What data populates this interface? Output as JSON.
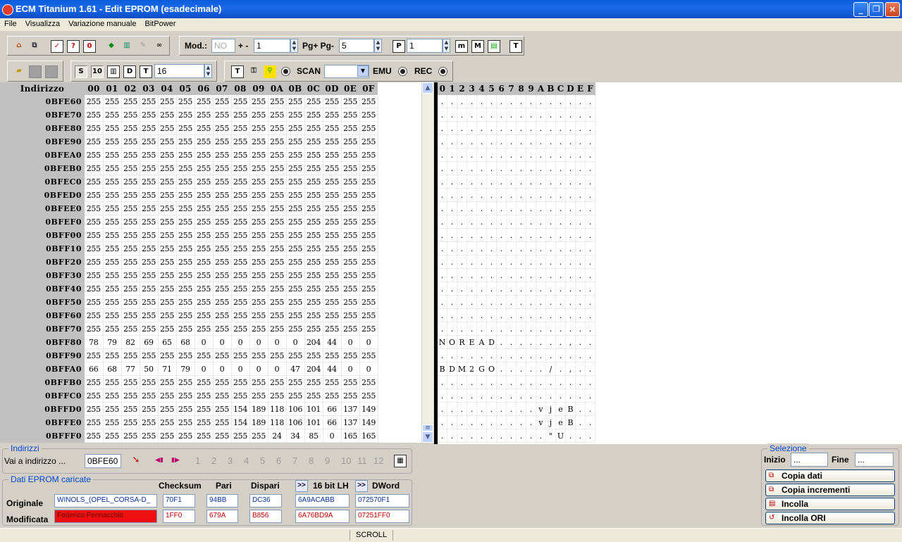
{
  "window": {
    "title": "ECM Titanium 1.61 - Edit EPROM (esadecimale)"
  },
  "menu": [
    "File",
    "Visualizza",
    "Variazione manuale",
    "BitPower"
  ],
  "toolbar1": {
    "mod_label": "Mod.:",
    "mod_value": "NO",
    "plusminus_label": "+ -",
    "plusminus_value": "1",
    "pg_label": "Pg+ Pg-",
    "pg_value": "5",
    "p_value": "1"
  },
  "toolbar2": {
    "width_value": "16",
    "scan_label": "SCAN",
    "scan_value": "",
    "emu_label": "EMU",
    "rec_label": "REC"
  },
  "hexgrid": {
    "address_header": "Indirizzo",
    "columns": [
      "00",
      "01",
      "02",
      "03",
      "04",
      "05",
      "06",
      "07",
      "08",
      "09",
      "0A",
      "0B",
      "0C",
      "0D",
      "0E",
      "0F"
    ],
    "rows": [
      {
        "addr": "0BFE60",
        "vals": [
          "255",
          "255",
          "255",
          "255",
          "255",
          "255",
          "255",
          "255",
          "255",
          "255",
          "255",
          "255",
          "255",
          "255",
          "255",
          "255"
        ],
        "ascii": [
          ".",
          ".",
          ".",
          ".",
          ".",
          ".",
          ".",
          ".",
          ".",
          ".",
          ".",
          ".",
          ".",
          ".",
          ".",
          "."
        ]
      },
      {
        "addr": "0BFE70",
        "vals": [
          "255",
          "255",
          "255",
          "255",
          "255",
          "255",
          "255",
          "255",
          "255",
          "255",
          "255",
          "255",
          "255",
          "255",
          "255",
          "255"
        ],
        "ascii": [
          ".",
          ".",
          ".",
          ".",
          ".",
          ".",
          ".",
          ".",
          ".",
          ".",
          ".",
          ".",
          ".",
          ".",
          ".",
          "."
        ]
      },
      {
        "addr": "0BFE80",
        "vals": [
          "255",
          "255",
          "255",
          "255",
          "255",
          "255",
          "255",
          "255",
          "255",
          "255",
          "255",
          "255",
          "255",
          "255",
          "255",
          "255"
        ],
        "ascii": [
          ".",
          ".",
          ".",
          ".",
          ".",
          ".",
          ".",
          ".",
          ".",
          ".",
          ".",
          ".",
          ".",
          ".",
          ".",
          "."
        ]
      },
      {
        "addr": "0BFE90",
        "vals": [
          "255",
          "255",
          "255",
          "255",
          "255",
          "255",
          "255",
          "255",
          "255",
          "255",
          "255",
          "255",
          "255",
          "255",
          "255",
          "255"
        ],
        "ascii": [
          ".",
          ".",
          ".",
          ".",
          ".",
          ".",
          ".",
          ".",
          ".",
          ".",
          ".",
          ".",
          ".",
          ".",
          ".",
          "."
        ]
      },
      {
        "addr": "0BFEA0",
        "vals": [
          "255",
          "255",
          "255",
          "255",
          "255",
          "255",
          "255",
          "255",
          "255",
          "255",
          "255",
          "255",
          "255",
          "255",
          "255",
          "255"
        ],
        "ascii": [
          ".",
          ".",
          ".",
          ".",
          ".",
          ".",
          ".",
          ".",
          ".",
          ".",
          ".",
          ".",
          ".",
          ".",
          ".",
          "."
        ]
      },
      {
        "addr": "0BFEB0",
        "vals": [
          "255",
          "255",
          "255",
          "255",
          "255",
          "255",
          "255",
          "255",
          "255",
          "255",
          "255",
          "255",
          "255",
          "255",
          "255",
          "255"
        ],
        "ascii": [
          ".",
          ".",
          ".",
          ".",
          ".",
          ".",
          ".",
          ".",
          ".",
          ".",
          ".",
          ".",
          ".",
          ".",
          ".",
          "."
        ]
      },
      {
        "addr": "0BFEC0",
        "vals": [
          "255",
          "255",
          "255",
          "255",
          "255",
          "255",
          "255",
          "255",
          "255",
          "255",
          "255",
          "255",
          "255",
          "255",
          "255",
          "255"
        ],
        "ascii": [
          ".",
          ".",
          ".",
          ".",
          ".",
          ".",
          ".",
          ".",
          ".",
          ".",
          ".",
          ".",
          ".",
          ".",
          ".",
          "."
        ]
      },
      {
        "addr": "0BFED0",
        "vals": [
          "255",
          "255",
          "255",
          "255",
          "255",
          "255",
          "255",
          "255",
          "255",
          "255",
          "255",
          "255",
          "255",
          "255",
          "255",
          "255"
        ],
        "ascii": [
          ".",
          ".",
          ".",
          ".",
          ".",
          ".",
          ".",
          ".",
          ".",
          ".",
          ".",
          ".",
          ".",
          ".",
          ".",
          "."
        ]
      },
      {
        "addr": "0BFEE0",
        "vals": [
          "255",
          "255",
          "255",
          "255",
          "255",
          "255",
          "255",
          "255",
          "255",
          "255",
          "255",
          "255",
          "255",
          "255",
          "255",
          "255"
        ],
        "ascii": [
          ".",
          ".",
          ".",
          ".",
          ".",
          ".",
          ".",
          ".",
          ".",
          ".",
          ".",
          ".",
          ".",
          ".",
          ".",
          "."
        ]
      },
      {
        "addr": "0BFEF0",
        "vals": [
          "255",
          "255",
          "255",
          "255",
          "255",
          "255",
          "255",
          "255",
          "255",
          "255",
          "255",
          "255",
          "255",
          "255",
          "255",
          "255"
        ],
        "ascii": [
          ".",
          ".",
          ".",
          ".",
          ".",
          ".",
          ".",
          ".",
          ".",
          ".",
          ".",
          ".",
          ".",
          ".",
          ".",
          "."
        ]
      },
      {
        "addr": "0BFF00",
        "vals": [
          "255",
          "255",
          "255",
          "255",
          "255",
          "255",
          "255",
          "255",
          "255",
          "255",
          "255",
          "255",
          "255",
          "255",
          "255",
          "255"
        ],
        "ascii": [
          ".",
          ".",
          ".",
          ".",
          ".",
          ".",
          ".",
          ".",
          ".",
          ".",
          ".",
          ".",
          ".",
          ".",
          ".",
          "."
        ]
      },
      {
        "addr": "0BFF10",
        "vals": [
          "255",
          "255",
          "255",
          "255",
          "255",
          "255",
          "255",
          "255",
          "255",
          "255",
          "255",
          "255",
          "255",
          "255",
          "255",
          "255"
        ],
        "ascii": [
          ".",
          ".",
          ".",
          ".",
          ".",
          ".",
          ".",
          ".",
          ".",
          ".",
          ".",
          ".",
          ".",
          ".",
          ".",
          "."
        ]
      },
      {
        "addr": "0BFF20",
        "vals": [
          "255",
          "255",
          "255",
          "255",
          "255",
          "255",
          "255",
          "255",
          "255",
          "255",
          "255",
          "255",
          "255",
          "255",
          "255",
          "255"
        ],
        "ascii": [
          ".",
          ".",
          ".",
          ".",
          ".",
          ".",
          ".",
          ".",
          ".",
          ".",
          ".",
          ".",
          ".",
          ".",
          ".",
          "."
        ]
      },
      {
        "addr": "0BFF30",
        "vals": [
          "255",
          "255",
          "255",
          "255",
          "255",
          "255",
          "255",
          "255",
          "255",
          "255",
          "255",
          "255",
          "255",
          "255",
          "255",
          "255"
        ],
        "ascii": [
          ".",
          ".",
          ".",
          ".",
          ".",
          ".",
          ".",
          ".",
          ".",
          ".",
          ".",
          ".",
          ".",
          ".",
          ".",
          "."
        ]
      },
      {
        "addr": "0BFF40",
        "vals": [
          "255",
          "255",
          "255",
          "255",
          "255",
          "255",
          "255",
          "255",
          "255",
          "255",
          "255",
          "255",
          "255",
          "255",
          "255",
          "255"
        ],
        "ascii": [
          ".",
          ".",
          ".",
          ".",
          ".",
          ".",
          ".",
          ".",
          ".",
          ".",
          ".",
          ".",
          ".",
          ".",
          ".",
          "."
        ]
      },
      {
        "addr": "0BFF50",
        "vals": [
          "255",
          "255",
          "255",
          "255",
          "255",
          "255",
          "255",
          "255",
          "255",
          "255",
          "255",
          "255",
          "255",
          "255",
          "255",
          "255"
        ],
        "ascii": [
          ".",
          ".",
          ".",
          ".",
          ".",
          ".",
          ".",
          ".",
          ".",
          ".",
          ".",
          ".",
          ".",
          ".",
          ".",
          "."
        ]
      },
      {
        "addr": "0BFF60",
        "vals": [
          "255",
          "255",
          "255",
          "255",
          "255",
          "255",
          "255",
          "255",
          "255",
          "255",
          "255",
          "255",
          "255",
          "255",
          "255",
          "255"
        ],
        "ascii": [
          ".",
          ".",
          ".",
          ".",
          ".",
          ".",
          ".",
          ".",
          ".",
          ".",
          ".",
          ".",
          ".",
          ".",
          ".",
          "."
        ]
      },
      {
        "addr": "0BFF70",
        "vals": [
          "255",
          "255",
          "255",
          "255",
          "255",
          "255",
          "255",
          "255",
          "255",
          "255",
          "255",
          "255",
          "255",
          "255",
          "255",
          "255"
        ],
        "ascii": [
          ".",
          ".",
          ".",
          ".",
          ".",
          ".",
          ".",
          ".",
          ".",
          ".",
          ".",
          ".",
          ".",
          ".",
          ".",
          "."
        ]
      },
      {
        "addr": "0BFF80",
        "vals": [
          "78",
          "79",
          "82",
          "69",
          "65",
          "68",
          "0",
          "0",
          "0",
          "0",
          "0",
          "0",
          "204",
          "44",
          "0",
          "0"
        ],
        "ascii": [
          "N",
          "O",
          "R",
          "E",
          "A",
          "D",
          ".",
          ".",
          ".",
          ".",
          ".",
          ".",
          ".",
          ",",
          ".",
          "."
        ]
      },
      {
        "addr": "0BFF90",
        "vals": [
          "255",
          "255",
          "255",
          "255",
          "255",
          "255",
          "255",
          "255",
          "255",
          "255",
          "255",
          "255",
          "255",
          "255",
          "255",
          "255"
        ],
        "ascii": [
          ".",
          ".",
          ".",
          ".",
          ".",
          ".",
          ".",
          ".",
          ".",
          ".",
          ".",
          ".",
          ".",
          ".",
          ".",
          "."
        ]
      },
      {
        "addr": "0BFFA0",
        "vals": [
          "66",
          "68",
          "77",
          "50",
          "71",
          "79",
          "0",
          "0",
          "0",
          "0",
          "0",
          "47",
          "204",
          "44",
          "0",
          "0"
        ],
        "ascii": [
          "B",
          "D",
          "M",
          "2",
          "G",
          "O",
          ".",
          ".",
          ".",
          ".",
          ".",
          "/",
          ".",
          ",",
          ".",
          "."
        ]
      },
      {
        "addr": "0BFFB0",
        "vals": [
          "255",
          "255",
          "255",
          "255",
          "255",
          "255",
          "255",
          "255",
          "255",
          "255",
          "255",
          "255",
          "255",
          "255",
          "255",
          "255"
        ],
        "ascii": [
          ".",
          ".",
          ".",
          ".",
          ".",
          ".",
          ".",
          ".",
          ".",
          ".",
          ".",
          ".",
          ".",
          ".",
          ".",
          "."
        ]
      },
      {
        "addr": "0BFFC0",
        "vals": [
          "255",
          "255",
          "255",
          "255",
          "255",
          "255",
          "255",
          "255",
          "255",
          "255",
          "255",
          "255",
          "255",
          "255",
          "255",
          "255"
        ],
        "ascii": [
          ".",
          ".",
          ".",
          ".",
          ".",
          ".",
          ".",
          ".",
          ".",
          ".",
          ".",
          ".",
          ".",
          ".",
          ".",
          "."
        ]
      },
      {
        "addr": "0BFFD0",
        "vals": [
          "255",
          "255",
          "255",
          "255",
          "255",
          "255",
          "255",
          "255",
          "154",
          "189",
          "118",
          "106",
          "101",
          "66",
          "137",
          "149"
        ],
        "ascii": [
          ".",
          ".",
          ".",
          ".",
          ".",
          ".",
          ".",
          ".",
          ".",
          ".",
          "v",
          "j",
          "e",
          "B",
          ".",
          "."
        ]
      },
      {
        "addr": "0BFFE0",
        "vals": [
          "255",
          "255",
          "255",
          "255",
          "255",
          "255",
          "255",
          "255",
          "154",
          "189",
          "118",
          "106",
          "101",
          "66",
          "137",
          "149"
        ],
        "ascii": [
          ".",
          ".",
          ".",
          ".",
          ".",
          ".",
          ".",
          ".",
          ".",
          ".",
          "v",
          "j",
          "e",
          "B",
          ".",
          "."
        ]
      },
      {
        "addr": "0BFFF0",
        "vals": [
          "255",
          "255",
          "255",
          "255",
          "255",
          "255",
          "255",
          "255",
          "255",
          "255",
          "24",
          "34",
          "85",
          "0",
          "165",
          "165"
        ],
        "ascii": [
          ".",
          ".",
          ".",
          ".",
          ".",
          ".",
          ".",
          ".",
          ".",
          ".",
          ".",
          "\"",
          "U",
          ".",
          ".",
          "."
        ]
      }
    ]
  },
  "ascii_header": [
    "0",
    "1",
    "2",
    "3",
    "4",
    "5",
    "6",
    "7",
    "8",
    "9",
    "A",
    "B",
    "C",
    "D",
    "E",
    "F"
  ],
  "indirizzi": {
    "title": "Indirizzi",
    "goto_label": "Vai a indirizzo ...",
    "goto_value": "0BFE60",
    "pages": [
      "1",
      "2",
      "3",
      "4",
      "5",
      "6",
      "7",
      "8",
      "9",
      "10",
      "11",
      "12"
    ]
  },
  "dati": {
    "title": "Dati EPROM caricate",
    "col_checksum": "Checksum",
    "col_pari": "Pari",
    "col_dispari": "Dispari",
    "col_16bit": "16 bit LH",
    "col_dword": "DWord",
    "swap_glyph": ">>",
    "originale": {
      "label": "Originale",
      "name": "WINOLS_(OPEL_CORSA-D_",
      "checksum": "70F1",
      "pari": "94BB",
      "dispari": "DC36",
      "bit16": "6A9ACABB",
      "dword": "072570F1"
    },
    "modificata": {
      "label": "Modificata",
      "name": "Federico Pennacchio",
      "checksum": "1FF0",
      "pari": "679A",
      "dispari": "B856",
      "bit16": "6A76BD9A",
      "dword": "07251FF0"
    }
  },
  "selezione": {
    "title": "Selezione",
    "inizio_label": "Inizio",
    "inizio_value": "...",
    "fine_label": "Fine",
    "fine_value": "...",
    "buttons": [
      "Copia dati",
      "Copia incrementi",
      "Incolla",
      "Incolla ORI"
    ]
  },
  "status": {
    "scroll": "SCROLL"
  },
  "colors": {
    "titlebar": "#0a5bdb",
    "header_bg": "#c0c0c0",
    "accent_blue": "#0046d5",
    "modified_red": "#ee1010"
  }
}
